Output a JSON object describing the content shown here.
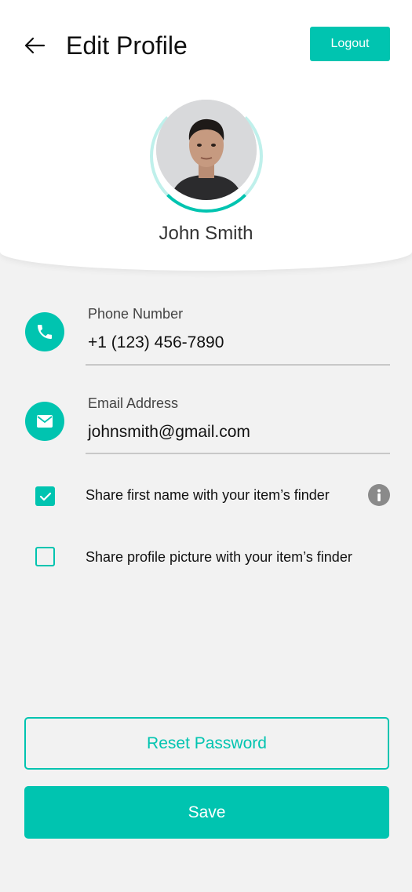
{
  "header": {
    "title": "Edit Profile",
    "logout_label": "Logout"
  },
  "profile": {
    "name": "John Smith"
  },
  "fields": {
    "phone": {
      "label": "Phone Number",
      "value": "+1 (123) 456-7890"
    },
    "email": {
      "label": "Email Address",
      "value": "johnsmith@gmail.com"
    }
  },
  "options": [
    {
      "label": "Share first name with your item’s finder",
      "checked": true
    },
    {
      "label": "Share profile picture with your item’s finder",
      "checked": false
    }
  ],
  "actions": {
    "reset_label": "Reset Password",
    "save_label": "Save"
  },
  "colors": {
    "accent": "#00c4b0",
    "background": "#f2f2f2"
  }
}
